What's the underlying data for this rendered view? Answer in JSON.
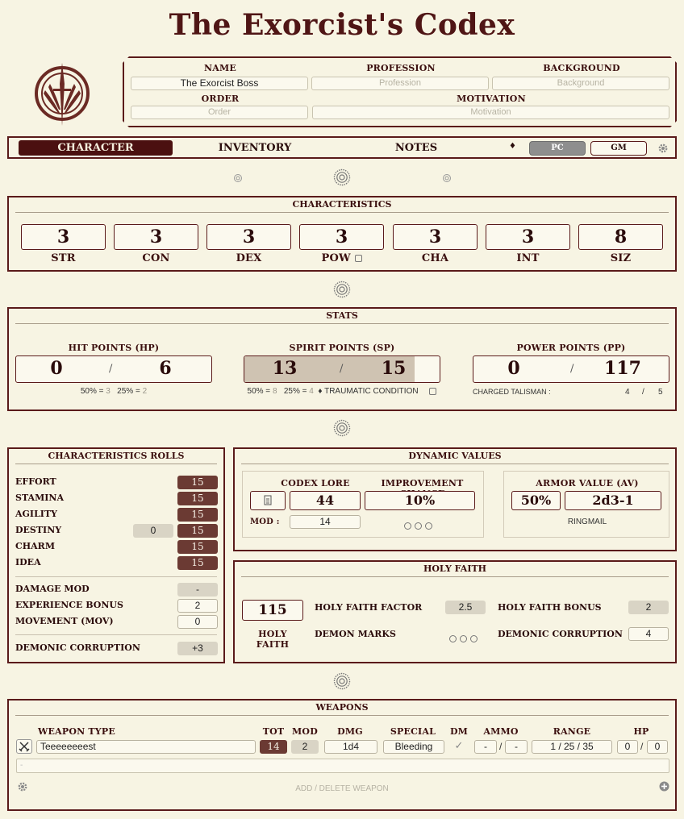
{
  "title": "The Exorcist's Codex",
  "bio": {
    "name_label": "NAME",
    "name_value": "The Exorcist Boss",
    "profession_label": "PROFESSION",
    "profession_placeholder": "Profession",
    "background_label": "BACKGROUND",
    "background_placeholder": "Background",
    "order_label": "ORDER",
    "order_placeholder": "Order",
    "motivation_label": "MOTIVATION",
    "motivation_placeholder": "Motivation"
  },
  "nav": {
    "tabs": [
      "CHARACTER",
      "INVENTORY",
      "NOTES"
    ],
    "diamond": "♦",
    "pc": "PC",
    "gm": "GM"
  },
  "characteristics": {
    "title": "CHARACTERISTICS",
    "items": [
      {
        "label": "STR",
        "value": "3"
      },
      {
        "label": "CON",
        "value": "3"
      },
      {
        "label": "DEX",
        "value": "3"
      },
      {
        "label": "POW",
        "value": "3"
      },
      {
        "label": "CHA",
        "value": "3"
      },
      {
        "label": "INT",
        "value": "3"
      },
      {
        "label": "SIZ",
        "value": "8"
      }
    ]
  },
  "stats": {
    "title": "STATS",
    "hp": {
      "label": "HIT POINTS (HP)",
      "current": "0",
      "max": "6",
      "half_label": "50% =",
      "half": "3",
      "quarter_label": "25% =",
      "quarter": "2"
    },
    "sp": {
      "label": "SPIRIT POINTS (SP)",
      "current": "13",
      "max": "15",
      "half_label": "50% =",
      "half": "8",
      "quarter_label": "25% =",
      "quarter": "4",
      "traumatic": "♦ TRAUMATIC CONDITION",
      "fill_fraction": 0.87
    },
    "pp": {
      "label": "POWER POINTS (PP)",
      "current": "0",
      "max": "117",
      "talisman_label": "CHARGED TALISMAN :",
      "talisman_current": "4",
      "talisman_max": "5"
    },
    "slash": "/"
  },
  "rolls": {
    "title": "CHARACTERISTICS ROLLS",
    "items": [
      {
        "label": "EFFORT",
        "value": "15"
      },
      {
        "label": "STAMINA",
        "value": "15"
      },
      {
        "label": "AGILITY",
        "value": "15"
      },
      {
        "label": "DESTINY",
        "value": "15",
        "extra": "0"
      },
      {
        "label": "CHARM",
        "value": "15"
      },
      {
        "label": "IDEA",
        "value": "15"
      }
    ],
    "damage_mod_label": "DAMAGE MOD",
    "damage_mod": "-",
    "xp_bonus_label": "EXPERIENCE BONUS",
    "xp_bonus": "2",
    "movement_label": "MOVEMENT (MOV)",
    "movement": "0",
    "demonic_label": "DEMONIC CORRUPTION",
    "demonic": "+3"
  },
  "dynamic": {
    "title": "DYNAMIC VALUES",
    "codex_lore_label": "CODEX LORE",
    "codex_lore": "44",
    "improvement_label": "IMPROVEMENT CHANCE",
    "improvement": "10%",
    "mod_label": "MOD :",
    "mod": "14",
    "armor_label": "ARMOR VALUE (AV)",
    "armor_pct": "50%",
    "armor_dice": "2d3-1",
    "armor_name": "RINGMAIL"
  },
  "faith": {
    "title": "HOLY FAITH",
    "value": "115",
    "value_label": "HOLY FAITH",
    "factor_label": "HOLY FAITH FACTOR",
    "factor": "2.5",
    "bonus_label": "HOLY FAITH BONUS",
    "bonus": "2",
    "marks_label": "DEMON MARKS",
    "corruption_label": "DEMONIC CORRUPTION",
    "corruption": "4"
  },
  "weapons": {
    "title": "WEAPONS",
    "headers": {
      "type": "WEAPON TYPE",
      "tot": "TOT",
      "mod": "MOD",
      "dmg": "DMG",
      "special": "SPECIAL",
      "dm": "DM",
      "ammo": "AMMO",
      "range": "RANGE",
      "hp": "HP"
    },
    "row": {
      "name": "Teeeeeeeest",
      "tot": "14",
      "mod": "2",
      "dmg": "1d4",
      "special": "Bleeding",
      "dm": "✓",
      "ammo_a": "-",
      "ammo_b": "-",
      "range": "1 / 25 / 35",
      "hp_a": "0",
      "hp_b": "0"
    },
    "notes_placeholder": "-",
    "add_delete": "ADD / DELETE WEAPON"
  },
  "colors": {
    "bg": "#f7f4e3",
    "accent": "#4b1010",
    "roll": "#6b3a33"
  }
}
